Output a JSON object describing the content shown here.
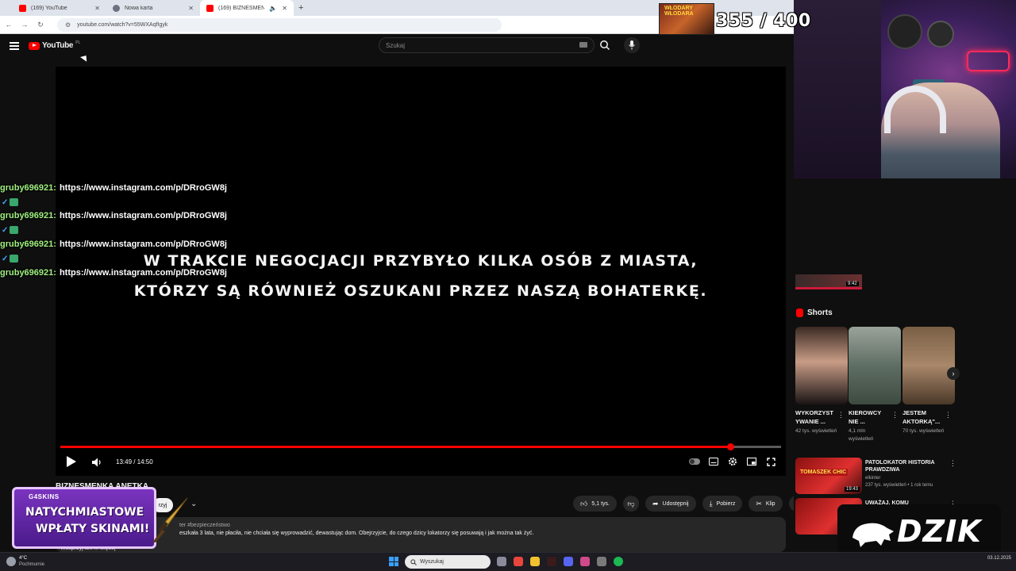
{
  "browser": {
    "tabs": [
      {
        "title": "(169) YouTube",
        "favicon": "youtube-icon",
        "active": false
      },
      {
        "title": "Nowa karta",
        "favicon": "globe-icon",
        "active": false
      },
      {
        "title": "(169) BIZNESMENKA ANETK",
        "favicon": "youtube-icon",
        "active": true
      }
    ],
    "new_tab_label": "+",
    "url": "youtube.com/watch?v=55WXAqfIgyk"
  },
  "youtube": {
    "logo_text": "YouTube",
    "region": "PL",
    "search_placeholder": "Szukaj"
  },
  "player": {
    "subtitle_line1": "W TRAKCIE NEGOCJACJI PRZYBYŁO KILKA OSÓB Z MIASTA,",
    "subtitle_line2": "KTÓRZY SĄ RÓWNIEŻ OSZUKANI PRZEZ NASZĄ BOHATERKĘ.",
    "time": "13:49 / 14:50",
    "progress": 0.93,
    "accent": "#ff0000"
  },
  "video": {
    "title": "BIZNESMENKA ANETKA",
    "subscribe_partial": "rzyj",
    "actions": {
      "likes": "5,1 tys.",
      "share": "Udostępnij",
      "download": "Pobierz",
      "clip": "Klip"
    },
    "description": {
      "tags": "ter  #bezpieczeństwo",
      "text": "eszkała 3 lata, nie płaciła, nie chciała się wyprowadzić, dewastując dom. Obejrzyjcie, do czego dzicy lokatorzy się posuwają i jak można tak żyć.",
      "more": "Wesprzyj ten ... więcej"
    }
  },
  "chat": {
    "user": "gruby696921",
    "messages": [
      {
        "user": "gruby696921:",
        "text": "https://www.instagram.com/p/DRroGW8j"
      },
      {
        "user": "gruby696921:",
        "text": "https://www.instagram.com/p/DRroGW8j"
      },
      {
        "user": "gruby696921:",
        "text": "https://www.instagram.com/p/DRroGW8j"
      },
      {
        "user": "gruby696921:",
        "text": "https://www.instagram.com/p/DRroGW8j"
      }
    ],
    "ghost_duration": "9:42"
  },
  "shorts": {
    "heading": "Shorts",
    "items": [
      {
        "title": "WYKORZYST YWANIE ...",
        "views": "42 tys. wyświetleń"
      },
      {
        "title": "KIEROWCY NIE ...",
        "views": "4,1 mln wyświetleń"
      },
      {
        "title": "JESTEM AKTORKĄ\"...",
        "views": "70 tys. wyświetleń"
      }
    ]
  },
  "recommendations": [
    {
      "title": "PATOLOKATOR HISTORIA PRAWDZIWA",
      "channel": "elkinter",
      "meta": "237 tys. wyświetleń • 1 rok temu",
      "duration": "19:43",
      "thumb_caption": "TOMASZEK CHIC"
    },
    {
      "title": "UWAŻAJ, KOMU",
      "channel": "",
      "meta": "",
      "duration": "",
      "thumb_caption": ""
    }
  ],
  "overlays": {
    "counter": "355 / 400",
    "counter_image_caption": "WŁODARY WŁODARA",
    "promo_brand": "G4SKINS",
    "promo_line1": "NATYCHMIASTOWE",
    "promo_line2": "WPŁATY SKINAMI!",
    "sponsor": "DZIK"
  },
  "taskbar": {
    "weather_temp": "4°C",
    "weather_desc": "Pochmurnie",
    "search_placeholder": "Wyszukaj",
    "date": "03.12.2025"
  }
}
